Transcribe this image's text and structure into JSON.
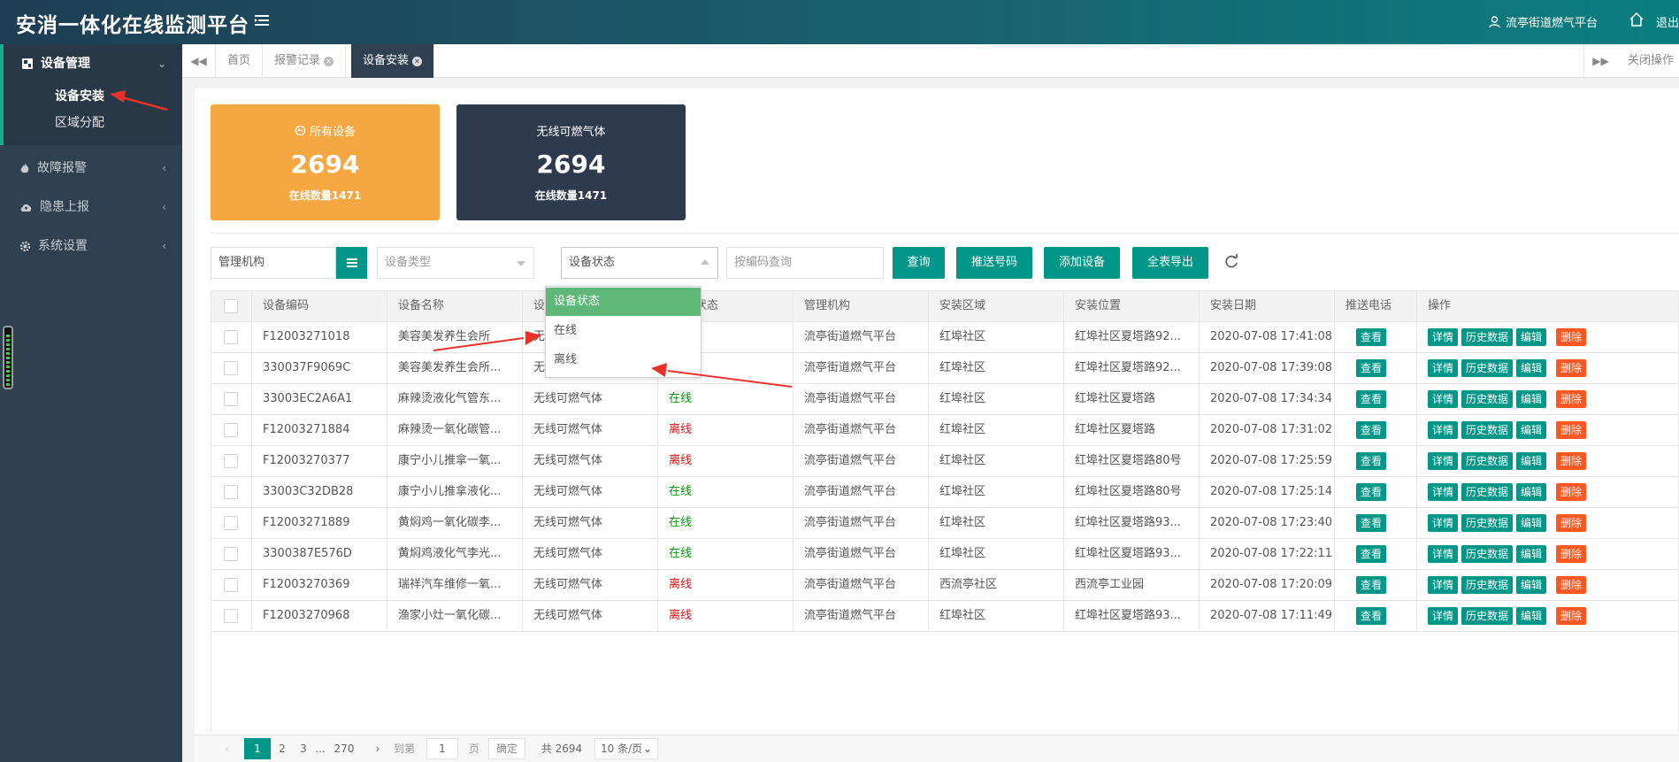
{
  "header": {
    "title": "安消一体化在线监测平台",
    "user": "流亭街道燃气平台",
    "exit": "退出"
  },
  "sidebar": {
    "groups": [
      {
        "label": "设备管理",
        "icon": "dashboard-icon",
        "expanded": true,
        "children": [
          "设备安装",
          "区域分配"
        ]
      },
      {
        "label": "故障报警",
        "icon": "fire-icon"
      },
      {
        "label": "隐患上报",
        "icon": "cloud-upload-icon"
      },
      {
        "label": "系统设置",
        "icon": "gear-icon"
      }
    ]
  },
  "tabs": {
    "items": [
      {
        "label": "首页",
        "closable": false
      },
      {
        "label": "报警记录",
        "closable": true
      },
      {
        "label": "设备安装",
        "closable": true,
        "active": true
      }
    ],
    "close_ops": "关闭操作"
  },
  "cards": [
    {
      "title": "所有设备",
      "count": "2694",
      "sub": "在线数量1471",
      "color": "#f5a742"
    },
    {
      "title": "无线可燃气体",
      "count": "2694",
      "sub": "在线数量1471",
      "color": "#2e3b4e"
    }
  ],
  "filters": {
    "org_value": "管理机构",
    "type_placeholder": "设备类型",
    "status_value": "设备状态",
    "code_placeholder": "按编码查询",
    "buttons": [
      "查询",
      "推送号码",
      "添加设备",
      "全表导出"
    ]
  },
  "status_dropdown": {
    "options": [
      "设备状态",
      "在线",
      "离线"
    ],
    "selected": "设备状态"
  },
  "table": {
    "headers": [
      "设备编码",
      "设备名称",
      "设",
      "状态",
      "管理机构",
      "安装区域",
      "安装位置",
      "安装日期",
      "推送电话",
      "操作"
    ],
    "row_buttons": {
      "view": "查看",
      "detail": "详情",
      "history": "历史数据",
      "edit": "编辑",
      "delete": "删除"
    },
    "rows": [
      {
        "code": "F12003271018",
        "name": "美容美发养生会所",
        "type": "无",
        "status": "",
        "org": "流亭街道燃气平台",
        "area": "红埠社区",
        "location": "红埠社区夏塔路92...",
        "date": "2020-07-08 17:41:08"
      },
      {
        "code": "330037F9069C",
        "name": "美容美发养生会所...",
        "type": "无",
        "status": "",
        "org": "流亭街道燃气平台",
        "area": "红埠社区",
        "location": "红埠社区夏塔路92...",
        "date": "2020-07-08 17:39:08"
      },
      {
        "code": "33003EC2A6A1",
        "name": "麻辣烫液化气管东...",
        "type": "无线可燃气体",
        "status": "在线",
        "org": "流亭街道燃气平台",
        "area": "红埠社区",
        "location": "红埠社区夏塔路",
        "date": "2020-07-08 17:34:34"
      },
      {
        "code": "F12003271884",
        "name": "麻辣烫一氧化碳管...",
        "type": "无线可燃气体",
        "status": "离线",
        "org": "流亭街道燃气平台",
        "area": "红埠社区",
        "location": "红埠社区夏塔路",
        "date": "2020-07-08 17:31:02"
      },
      {
        "code": "F12003270377",
        "name": "康宁小儿推拿一氧...",
        "type": "无线可燃气体",
        "status": "离线",
        "org": "流亭街道燃气平台",
        "area": "红埠社区",
        "location": "红埠社区夏塔路80号",
        "date": "2020-07-08 17:25:59"
      },
      {
        "code": "33003C32DB28",
        "name": "康宁小儿推拿液化...",
        "type": "无线可燃气体",
        "status": "在线",
        "org": "流亭街道燃气平台",
        "area": "红埠社区",
        "location": "红埠社区夏塔路80号",
        "date": "2020-07-08 17:25:14"
      },
      {
        "code": "F12003271889",
        "name": "黄焖鸡一氧化碳李...",
        "type": "无线可燃气体",
        "status": "在线",
        "org": "流亭街道燃气平台",
        "area": "红埠社区",
        "location": "红埠社区夏塔路93...",
        "date": "2020-07-08 17:23:40"
      },
      {
        "code": "3300387E576D",
        "name": "黄焖鸡液化气李光...",
        "type": "无线可燃气体",
        "status": "在线",
        "org": "流亭街道燃气平台",
        "area": "红埠社区",
        "location": "红埠社区夏塔路93...",
        "date": "2020-07-08 17:22:11"
      },
      {
        "code": "F12003270369",
        "name": "瑞祥汽车维修一氧...",
        "type": "无线可燃气体",
        "status": "离线",
        "org": "流亭街道燃气平台",
        "area": "西流亭社区",
        "location": "西流亭工业园",
        "date": "2020-07-08 17:20:09"
      },
      {
        "code": "F12003270968",
        "name": "渔家小灶一氧化碳...",
        "type": "无线可燃气体",
        "status": "离线",
        "org": "流亭街道燃气平台",
        "area": "红埠社区",
        "location": "红埠社区夏塔路93...",
        "date": "2020-07-08 17:11:49"
      }
    ]
  },
  "pagination": {
    "current": "1",
    "next": "2",
    "near_last": "3",
    "ellipsis": "...",
    "last": "270",
    "goto_label": "到第",
    "page_input": "1",
    "page_unit": "页",
    "confirm": "确定",
    "total": "共 2694 条",
    "page_size": "10 条/页"
  },
  "colors": {
    "accent": "#009688",
    "sidebar": "#2f4050",
    "danger": "#ff5722",
    "online": "#009900",
    "offline": "#e81010",
    "annotation": "#e8312a"
  }
}
